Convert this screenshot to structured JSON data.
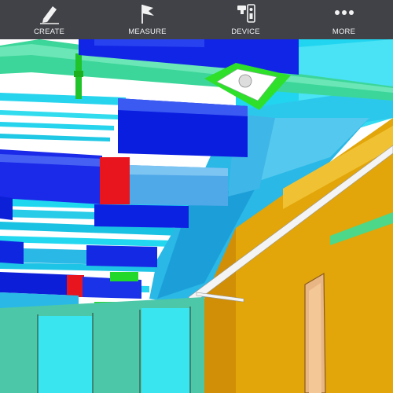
{
  "toolbar": {
    "items": [
      {
        "label": "CREATE",
        "icon": "pencil-icon"
      },
      {
        "label": "MEASURE",
        "icon": "flag-icon"
      },
      {
        "label": "DEVICE",
        "icon": "device-icon"
      },
      {
        "label": "MORE",
        "icon": "more-dots-icon"
      }
    ]
  },
  "colors": {
    "toolbar_bg": "#34363c",
    "duct_blue": "#0a1ee0",
    "duct_cyan": "#22d8f0",
    "duct_light": "#2ab8e6",
    "wall_orange": "#e2a50a",
    "accent_red": "#e8141e",
    "pipe_green": "#3cd69a",
    "diffuser_green": "#2ee02a",
    "glass_teal": "#4cc8a8",
    "ceiling_white": "#ffffff"
  },
  "scene": {
    "type": "3d-bim-model",
    "description_elements": [
      "ducts",
      "pipes",
      "diffuser",
      "walls",
      "door",
      "glass-partition"
    ]
  }
}
